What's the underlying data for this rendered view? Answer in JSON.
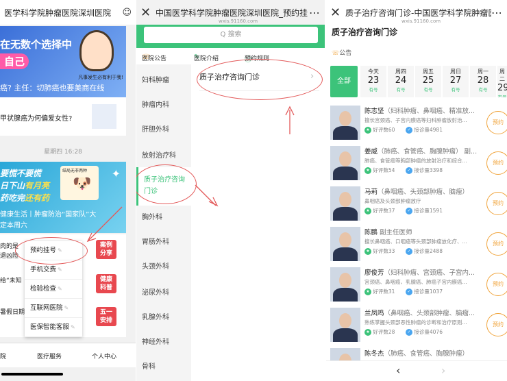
{
  "panel1": {
    "title": "医学科学院肿瘤医院深圳医院",
    "banner1": {
      "line1": "在无数个选择中",
      "line2": "自己",
      "line3": "癌? 主任：切肺癌也要美商在线",
      "image_caption": "凡事发生必有利于我!"
    },
    "card1": {
      "title": "甲状腺癌为何偏爱女性?"
    },
    "date": "星期四 16:28",
    "banner2": {
      "line1": "要慌不要慌",
      "line2_pre": "日下山",
      "line2_hi": "有月亮",
      "line3_pre": "药吃完",
      "line3_hi": "还有药",
      "caption": "健康生活丨肿瘤防治“国家队”大",
      "caption2": "定本周六",
      "image_caption": "结局无非两种"
    },
    "snippets": [
      "肉的是",
      "退凶险",
      "给“未知",
      "暑假日期("
    ],
    "tags": [
      {
        "text": "案例\n分享"
      },
      {
        "text": "健康\n科普"
      },
      {
        "text": "五一\n安排"
      }
    ],
    "menu_items": [
      "预约挂号",
      "手机交费",
      "检验检查",
      "互联网医院",
      "医保智能客服"
    ],
    "tabbar": [
      "院",
      "医疗服务",
      "个人中心"
    ]
  },
  "panel2": {
    "title": "中国医学科学院肿瘤医院深圳医院_预约挂",
    "subtitle": "wxis.91160.com",
    "search_placeholder": "Q 搜索",
    "notices": [
      "医院公告",
      "医院介绍",
      "预约规则"
    ],
    "departments": [
      "妇科肿瘤",
      "肿瘤内科",
      "肝胆外科",
      "放射治疗科",
      "质子治疗咨询门诊",
      "胸外科",
      "胃肠外科",
      "头颈外科",
      "泌尿外科",
      "乳腺外科",
      "神经外科",
      "骨科"
    ],
    "selected_department": "质子治疗咨询门诊",
    "right_item": "质子治疗咨询门诊"
  },
  "panel3": {
    "title": "质子治疗咨询门诊-中国医学科学院肿瘤医",
    "subtitle": "wxis.91160.com",
    "heading": "质子治疗咨询门诊",
    "announcement": "公告",
    "all_label": "全部",
    "dates": [
      {
        "week": "今天",
        "day": "23",
        "status": "有号"
      },
      {
        "week": "周四",
        "day": "24",
        "status": "有号"
      },
      {
        "week": "周五",
        "day": "25",
        "status": "有号"
      },
      {
        "week": "周日",
        "day": "27",
        "status": "有号"
      },
      {
        "week": "周一",
        "day": "28",
        "status": "有号"
      },
      {
        "week": "周二",
        "day": "29",
        "status": "有号"
      }
    ],
    "doctors": [
      {
        "name": "陈志坚",
        "title": "（妇科肿瘤、鼻咽癌、精准放...",
        "desc": "擅长宫颈癌、子宫内膜癌等妇科肿瘤放射治...",
        "reviews": "好评数60",
        "visits": "接诊量4981",
        "book": "预约"
      },
      {
        "name": "姜威",
        "title": "（肺癌、食管癌、胸腺肿瘤） 副...",
        "desc": "肺癌、食管癌等胸部肿瘤的放射治疗和综合...",
        "reviews": "好评数54",
        "visits": "接诊量3398",
        "book": "预约"
      },
      {
        "name": "马莉",
        "title": "（鼻咽癌、头颈部肿瘤、脑瘤）",
        "desc": "鼻咽癌及头颈部肿瘤放疗",
        "reviews": "好评数37",
        "visits": "接诊量1591",
        "book": "预约"
      },
      {
        "name": "陈鹏",
        "title": "副主任医师",
        "desc": "擅长鼻咽癌、口咽癌等头颈部肿瘤放化疗、...",
        "reviews": "好评数33",
        "visits": "接诊量2488",
        "book": "预约"
      },
      {
        "name": "廖俊芳",
        "title": "（妇科肿瘤、宫颈癌、子宫内...",
        "desc": "宫颈癌、鼻咽癌、乳腺癌、肺癌子宫内膜癌...",
        "reviews": "好评数31",
        "visits": "接诊量1037",
        "book": "预约"
      },
      {
        "name": "兰凤鸣",
        "title": "（鼻咽癌、头颈部肿瘤、脑瘤...",
        "desc": "熟练掌握头颈部恶性肿瘤的诊断和治疗原则...",
        "reviews": "好评数28",
        "visits": "接诊量4076",
        "book": "预约"
      },
      {
        "name": "陈冬杰",
        "title": "（肺癌、食管癌、胸腺肿瘤）",
        "desc": "",
        "reviews": "",
        "visits": "",
        "book": ""
      }
    ]
  }
}
